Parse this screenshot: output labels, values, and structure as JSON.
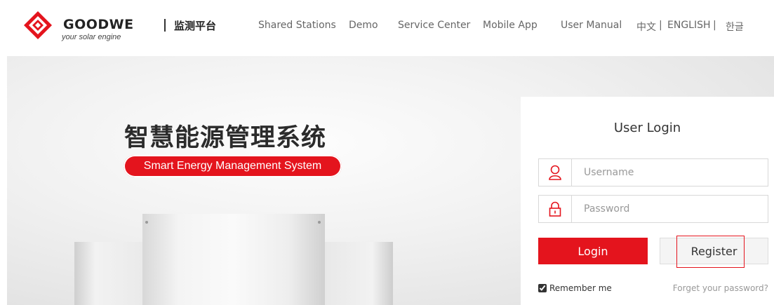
{
  "header": {
    "logo_text": "GOODWE",
    "logo_tagline": "your solar engine",
    "platform_name": "监测平台",
    "nav": [
      {
        "label": "Shared Stations"
      },
      {
        "label": "Demo"
      },
      {
        "label": "Service Center"
      },
      {
        "label": "Mobile App"
      },
      {
        "label": "User Manual"
      }
    ],
    "languages": {
      "zh": "中文",
      "en": "ENGLISH",
      "ko": "한글",
      "separator": "|"
    }
  },
  "hero": {
    "title_cn": "智慧能源管理系统",
    "title_en": "Smart Energy Management System"
  },
  "login": {
    "title": "User Login",
    "username_placeholder": "Username",
    "password_placeholder": "Password",
    "login_label": "Login",
    "register_label": "Register",
    "remember_label": "Remember me",
    "remember_checked": true,
    "forgot_label": "Forget your password?"
  },
  "colors": {
    "accent": "#e4141d",
    "text": "#333333",
    "nav_text": "#666666"
  },
  "icons": {
    "username": "user-icon",
    "password": "lock-icon"
  }
}
